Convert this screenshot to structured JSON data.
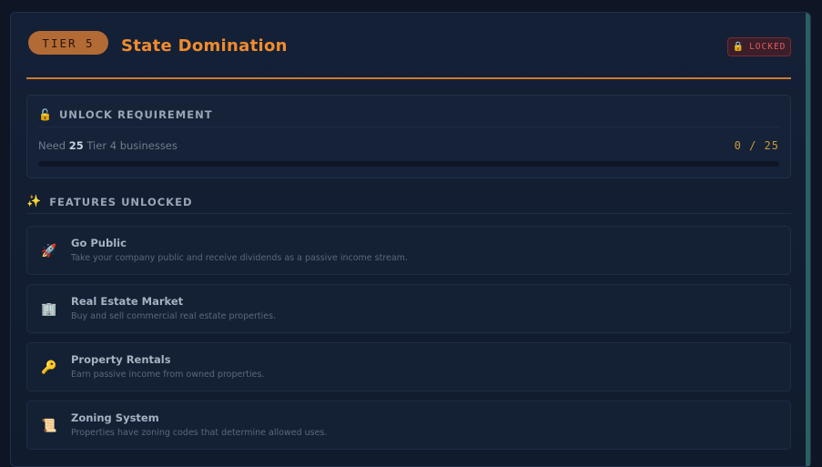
{
  "tier": {
    "badge": "TIER 5",
    "title": "State Domination",
    "status": "LOCKED",
    "status_icon": "lock-icon",
    "accent_color": "#f08c2e",
    "badge_color": "#b36b35"
  },
  "requirement": {
    "heading": "UNLOCK REQUIREMENT",
    "icon": "unlock-icon",
    "text_prefix": "Need",
    "required_count": "25",
    "text_suffix": "Tier 4 businesses",
    "progress_text": "0 / 25",
    "progress_fraction": 0
  },
  "features": {
    "heading": "FEATURES UNLOCKED",
    "icon": "sparkles-icon",
    "items": [
      {
        "name": "Go Public",
        "description": "Take your company public and receive dividends as a passive income stream.",
        "icon": "rocket-icon"
      },
      {
        "name": "Real Estate Market",
        "description": "Buy and sell commercial real estate properties.",
        "icon": "building-icon"
      },
      {
        "name": "Property Rentals",
        "description": "Earn passive income from owned properties.",
        "icon": "key-icon"
      },
      {
        "name": "Zoning System",
        "description": "Properties have zoning codes that determine allowed uses.",
        "icon": "scroll-icon"
      }
    ]
  }
}
